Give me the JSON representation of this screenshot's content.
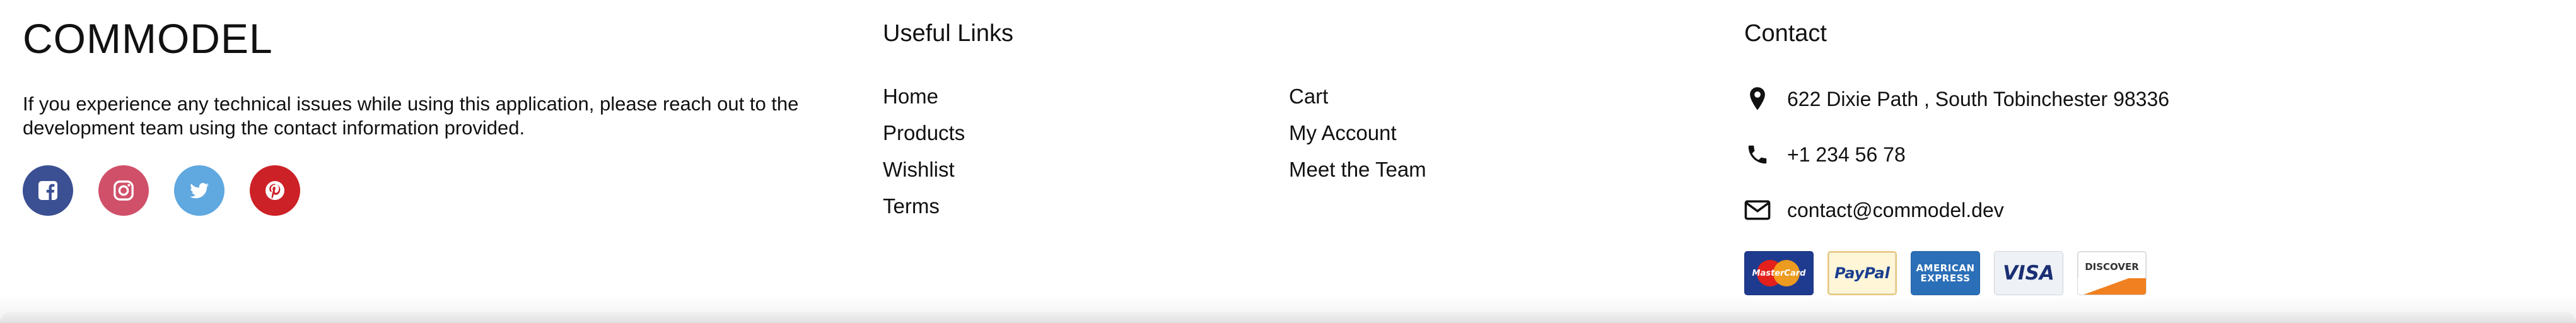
{
  "brand": {
    "name": "COMMODEL",
    "description": "If you experience any technical issues while using this application, please reach out to the development team using the contact information provided."
  },
  "socials": [
    {
      "name": "facebook",
      "icon": "facebook-icon",
      "color": "#3b4f93"
    },
    {
      "name": "instagram",
      "icon": "instagram-icon",
      "color": "#d0506a"
    },
    {
      "name": "twitter",
      "icon": "twitter-icon",
      "color": "#5fa8e0"
    },
    {
      "name": "pinterest",
      "icon": "pinterest-icon",
      "color": "#cc2127"
    }
  ],
  "useful_links": {
    "title": "Useful Links",
    "column_a": [
      "Home",
      "Products",
      "Wishlist",
      "Terms"
    ],
    "column_b": [
      "Cart",
      "My Account",
      "Meet the Team"
    ]
  },
  "contact": {
    "title": "Contact",
    "address": "622 Dixie Path , South Tobinchester 98336",
    "phone": "+1 234 56 78",
    "email": "contact@commodel.dev"
  },
  "payments": [
    {
      "name": "MasterCard",
      "label": "MasterCard"
    },
    {
      "name": "PayPal",
      "label": "PayPal"
    },
    {
      "name": "American Express",
      "label": "AMERICAN EXPRESS"
    },
    {
      "name": "Visa",
      "label": "VISA"
    },
    {
      "name": "Discover",
      "label": "DISCOVER"
    }
  ]
}
